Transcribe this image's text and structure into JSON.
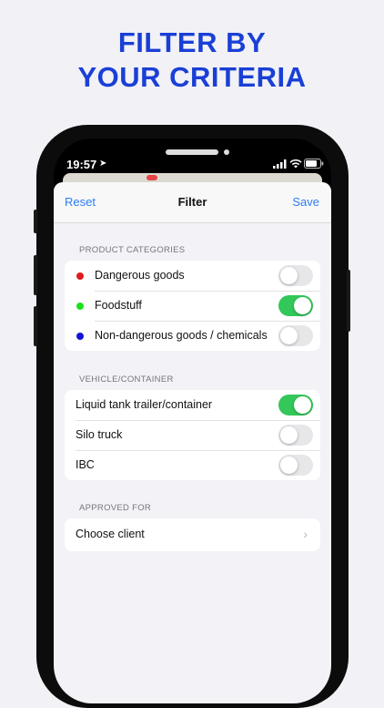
{
  "headline": {
    "line1": "FILTER BY",
    "line2": "YOUR CRITERIA"
  },
  "status_bar": {
    "time": "19:57"
  },
  "navbar": {
    "left": "Reset",
    "title": "Filter",
    "right": "Save"
  },
  "sections": [
    {
      "header": "PRODUCT CATEGORIES",
      "rows": [
        {
          "label": "Dangerous goods",
          "dot_color": "#e01b1b",
          "toggle_on": false
        },
        {
          "label": "Foodstuff",
          "dot_color": "#1de01d",
          "toggle_on": true
        },
        {
          "label": "Non-dangerous goods / chemicals",
          "dot_color": "#1414d6",
          "toggle_on": false
        }
      ]
    },
    {
      "header": "VEHICLE/CONTAINER",
      "rows": [
        {
          "label": "Liquid tank trailer/container",
          "toggle_on": true
        },
        {
          "label": "Silo truck",
          "toggle_on": false
        },
        {
          "label": "IBC",
          "toggle_on": false
        }
      ]
    },
    {
      "header": "APPROVED FOR",
      "rows": [
        {
          "label": "Choose client",
          "icon": "chevron-right-icon"
        }
      ]
    }
  ],
  "colors": {
    "headline": "#1a3fd6",
    "accent": "#2d7cf6",
    "toggle_on": "#34c759",
    "toggle_off": "#e7e7ea"
  }
}
